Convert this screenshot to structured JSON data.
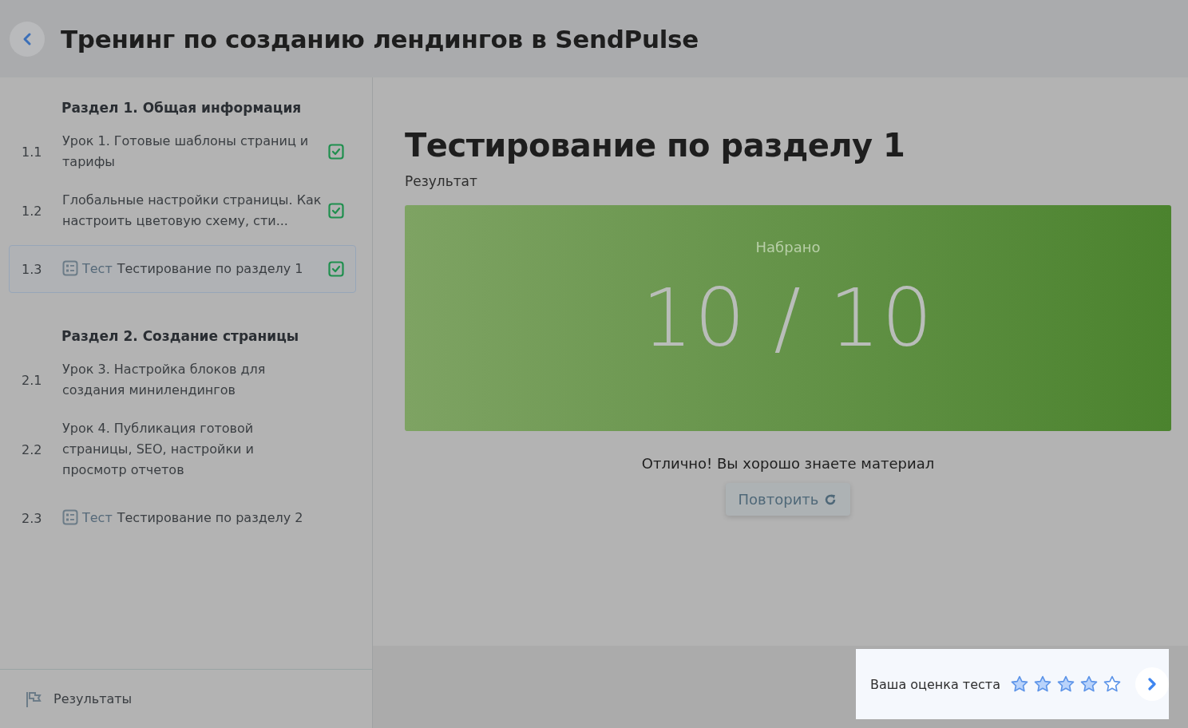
{
  "header": {
    "title": "Тренинг по созданию лендингов в SendPulse"
  },
  "sidebar": {
    "sections": [
      {
        "title": "Раздел 1. Общая информация",
        "items": [
          {
            "number": "1.1",
            "kind": "lesson",
            "title": "Урок 1. Готовые шаблоны страниц и тарифы",
            "done": true,
            "selected": false
          },
          {
            "number": "1.2",
            "kind": "lesson",
            "title": "Глобальные настройки страницы. Как настроить цветовую схему, сти...",
            "done": true,
            "selected": false
          },
          {
            "number": "1.3",
            "kind": "test",
            "tag": "Тест",
            "title": "Тестирование по разделу 1",
            "done": true,
            "selected": true
          }
        ]
      },
      {
        "title": "Раздел 2. Создание страницы",
        "items": [
          {
            "number": "2.1",
            "kind": "lesson",
            "title": "Урок 3. Настройка блоков для создания минилендингов",
            "done": false,
            "selected": false
          },
          {
            "number": "2.2",
            "kind": "lesson",
            "title": "Урок 4. Публикация готовой страницы, SEO, настройки и просмотр отчетов",
            "done": false,
            "selected": false
          },
          {
            "number": "2.3",
            "kind": "test",
            "tag": "Тест",
            "title": "Тестирование по разделу 2",
            "done": false,
            "selected": false
          }
        ]
      }
    ],
    "results_link": "Результаты"
  },
  "main": {
    "title": "Тестирование по разделу 1",
    "subtitle": "Результат",
    "score_label": "Набрано",
    "score": "10 / 10",
    "message": "Отлично! Вы хорошо знаете материал",
    "retry_button": "Повторить"
  },
  "rating": {
    "label": "Ваша оценка теста",
    "stars": 4
  }
}
